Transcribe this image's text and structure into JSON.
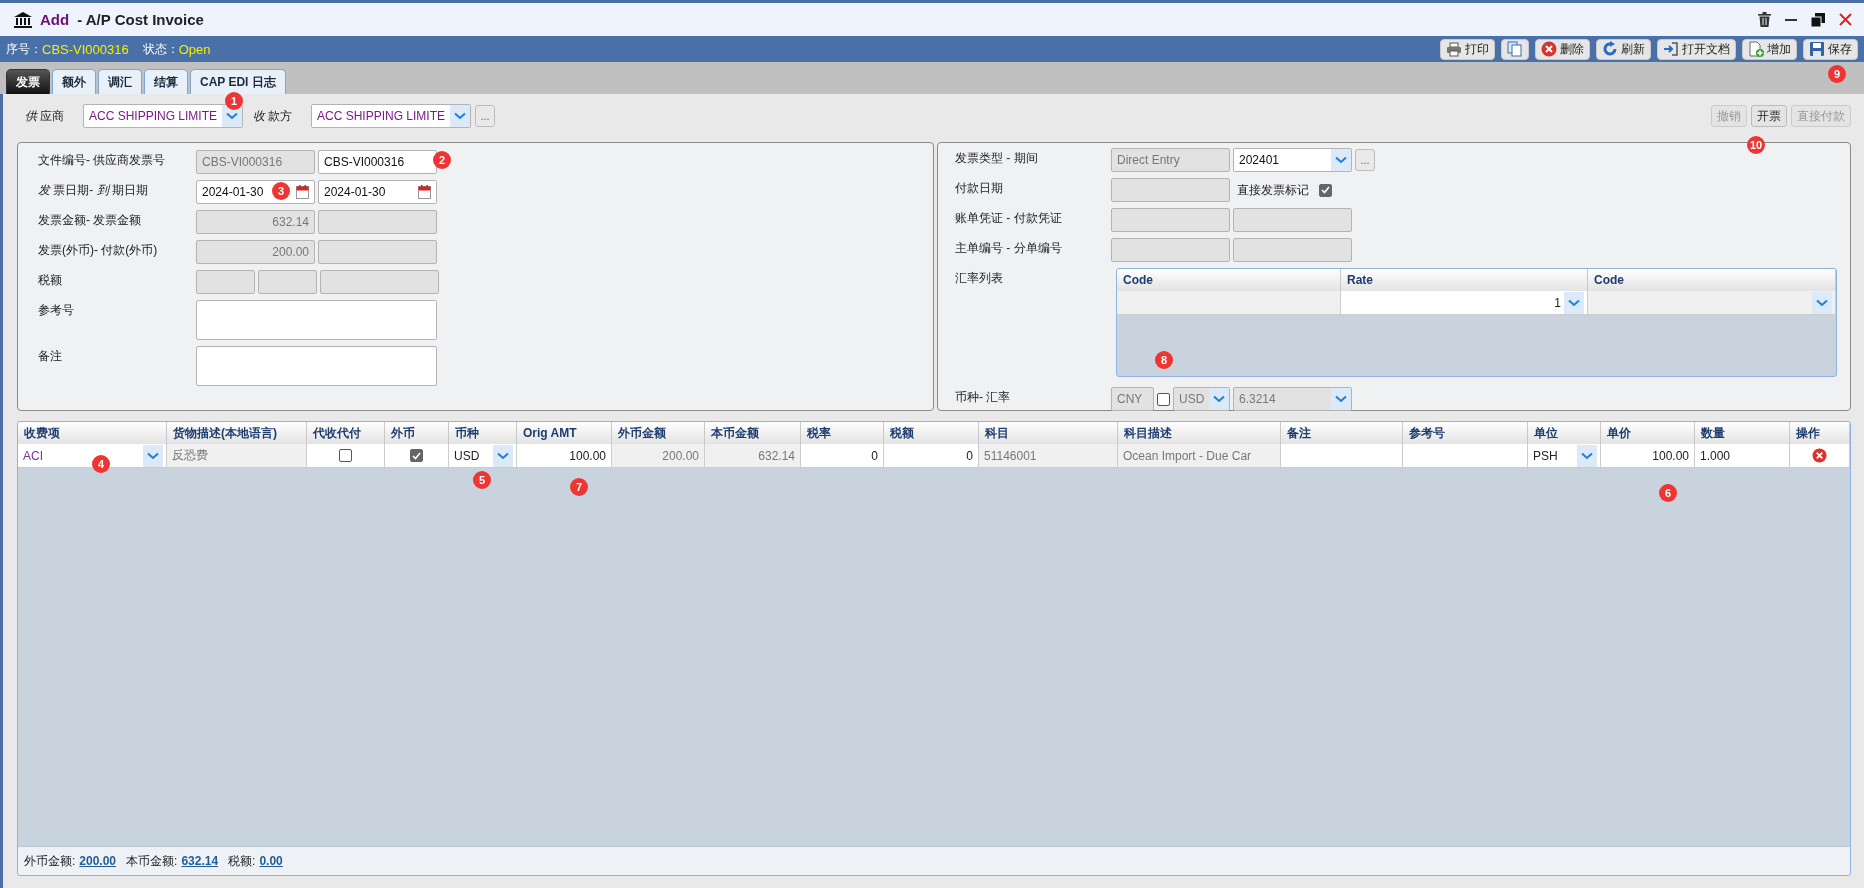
{
  "window": {
    "action": "Add",
    "title": "- A/P Cost Invoice"
  },
  "status": [
    {
      "label": "序号：",
      "value": "CBS-VI000316"
    },
    {
      "label": "状态：",
      "value": "Open"
    }
  ],
  "toolbar": [
    {
      "kind": "print",
      "label": "打印"
    },
    {
      "kind": "copy"
    },
    {
      "kind": "delete",
      "label": "删除"
    },
    {
      "kind": "refresh",
      "label": "刷新"
    },
    {
      "kind": "open",
      "label": "打开文档"
    },
    {
      "kind": "add",
      "label": "增加"
    },
    {
      "kind": "save",
      "label": "保存"
    }
  ],
  "tabs": [
    {
      "label": "发票",
      "selected": true
    },
    {
      "label": "额外",
      "selected": false
    },
    {
      "label": "调汇",
      "selected": false
    },
    {
      "label": "结算",
      "selected": false
    },
    {
      "label": "CAP EDI 日志",
      "selected": false
    }
  ],
  "parties": [
    {
      "label": "*供* 应商",
      "value": "ACC SHIPPING LIMITE"
    },
    {
      "label": "*收* 款方",
      "value": "ACC SHIPPING LIMITE",
      "more": "..."
    }
  ],
  "actions": [
    {
      "label": "撤销",
      "disabled": true
    },
    {
      "label": "开票",
      "disabled": false
    },
    {
      "label": "直接付款",
      "disabled": true
    }
  ],
  "invoice_form": [
    {
      "label": "文件编号- 供应商发票号",
      "fields": [
        {
          "kind": "readonly",
          "value": "CBS-VI000316"
        },
        {
          "kind": "input",
          "value": "CBS-VI000316"
        }
      ]
    },
    {
      "label": "*发* 票日期- *到* 期日期",
      "fields": [
        {
          "kind": "date",
          "value": "2024-01-30"
        },
        {
          "kind": "date",
          "value": "2024-01-30"
        }
      ]
    },
    {
      "label": "发票金额- 发票金额",
      "fields": [
        {
          "kind": "readonly-number",
          "value": "632.14"
        },
        {
          "kind": "readonly"
        }
      ]
    },
    {
      "label": "发票(外币)- 付款(外币)",
      "fields": [
        {
          "kind": "readonly-number",
          "value": "200.00"
        },
        {
          "kind": "readonly"
        }
      ]
    },
    {
      "label": "税额",
      "fields": [
        {
          "kind": "readonly-small"
        },
        {
          "kind": "readonly-small"
        },
        {
          "kind": "readonly"
        }
      ]
    },
    {
      "label": "参考号",
      "fields": [
        {
          "kind": "textarea"
        }
      ]
    },
    {
      "label": "备注",
      "fields": [
        {
          "kind": "textarea"
        }
      ]
    }
  ],
  "account_form": [
    {
      "label": "发票类型 - 期间",
      "fields": [
        {
          "kind": "readonly",
          "value": "Direct Entry"
        },
        {
          "kind": "select",
          "value": "202401"
        },
        {
          "kind": "more",
          "value": "..."
        }
      ]
    },
    {
      "label": "付款日期",
      "fields": [
        {
          "kind": "readonly"
        },
        {
          "kind": "check-label",
          "value": "直接发票标记",
          "checked": true
        }
      ]
    },
    {
      "label": "账单凭证 - 付款凭证",
      "fields": [
        {
          "kind": "readonly"
        },
        {
          "kind": "readonly"
        }
      ]
    },
    {
      "label": "主单编号 - 分单编号",
      "fields": [
        {
          "kind": "readonly"
        },
        {
          "kind": "readonly"
        }
      ]
    },
    {
      "label": "汇率列表",
      "table": {
        "columns": [
          "Code",
          "Rate",
          "Code"
        ],
        "cells": [
          {
            "kind": "readonly"
          },
          {
            "kind": "select-number",
            "value": "1"
          },
          {
            "kind": "select-disabled"
          }
        ]
      }
    },
    {
      "label": "币种- 汇率",
      "fields": [
        {
          "kind": "readonly-tiny",
          "value": "CNY"
        },
        {
          "kind": "checkbox",
          "checked": false
        },
        {
          "kind": "select-small-disabled",
          "value": "USD"
        },
        {
          "kind": "select-disabled",
          "value": "6.3214"
        }
      ]
    }
  ],
  "grid": {
    "columns": [
      "收费项",
      "货物描述(本地语言)",
      "代收代付",
      "外币",
      "币种",
      "Orig AMT",
      "外币金额",
      "本币金额",
      "税率",
      "税额",
      "科目",
      "科目描述",
      "备注",
      "参考号",
      "单位",
      "单价",
      "数量",
      "操作"
    ],
    "rows": [
      {
        "cells": [
          {
            "kind": "select",
            "value": "ACI"
          },
          {
            "kind": "readonly",
            "value": "反恐费"
          },
          {
            "kind": "checkbox",
            "checked": false
          },
          {
            "kind": "checkbox",
            "checked": true
          },
          {
            "kind": "select",
            "value": "USD"
          },
          {
            "kind": "number",
            "value": "100.00"
          },
          {
            "kind": "readonly-number",
            "value": "200.00"
          },
          {
            "kind": "readonly-number",
            "value": "632.14"
          },
          {
            "kind": "number",
            "value": "0"
          },
          {
            "kind": "number",
            "value": "0"
          },
          {
            "kind": "readonly",
            "value": "51146001"
          },
          {
            "kind": "readonly",
            "value": "Ocean Import - Due Car"
          },
          {
            "kind": "input"
          },
          {
            "kind": "input"
          },
          {
            "kind": "select",
            "value": "PSH"
          },
          {
            "kind": "number",
            "value": "100.00"
          },
          {
            "kind": "input",
            "value": "1.000"
          },
          {
            "kind": "delete"
          }
        ]
      }
    ],
    "totals": [
      {
        "label": "外币金额:",
        "value": "200.00"
      },
      {
        "label": "本币金额:",
        "value": "632.14"
      },
      {
        "label": "税额:",
        "value": "0.00"
      }
    ]
  },
  "callouts": [
    {
      "label": "1"
    },
    {
      "label": "2"
    },
    {
      "label": "3"
    },
    {
      "label": "4"
    },
    {
      "label": "5"
    },
    {
      "label": "6"
    },
    {
      "label": "7"
    },
    {
      "label": "8"
    },
    {
      "label": "9"
    },
    {
      "label": "10"
    }
  ]
}
